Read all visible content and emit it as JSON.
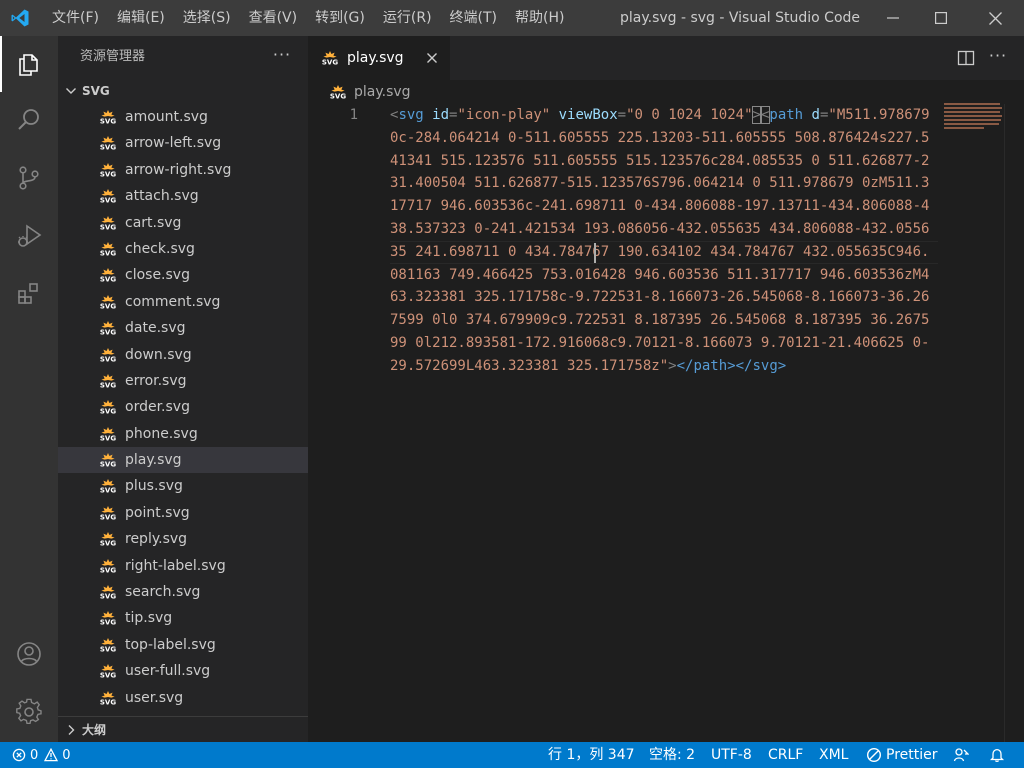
{
  "window": {
    "title": "play.svg - svg - Visual Studio Code",
    "menu": [
      "文件(F)",
      "编辑(E)",
      "选择(S)",
      "查看(V)",
      "转到(G)",
      "运行(R)",
      "终端(T)",
      "帮助(H)"
    ]
  },
  "activity_bar": {
    "items": [
      "explorer-icon",
      "search-icon",
      "source-control-icon",
      "run-debug-icon",
      "extensions-icon"
    ],
    "bottom": [
      "account-icon",
      "settings-gear-icon"
    ],
    "active": "explorer-icon"
  },
  "sidebar": {
    "title": "资源管理器",
    "more": "···",
    "folder": "SVG",
    "files": [
      "amount.svg",
      "arrow-left.svg",
      "arrow-right.svg",
      "attach.svg",
      "cart.svg",
      "check.svg",
      "close.svg",
      "comment.svg",
      "date.svg",
      "down.svg",
      "error.svg",
      "order.svg",
      "phone.svg",
      "play.svg",
      "plus.svg",
      "point.svg",
      "reply.svg",
      "right-label.svg",
      "search.svg",
      "tip.svg",
      "top-label.svg",
      "user-full.svg",
      "user.svg"
    ],
    "selected_file": "play.svg",
    "outline_label": "大纲"
  },
  "editor": {
    "tab_label": "play.svg",
    "breadcrumb": "play.svg",
    "more": "···",
    "line_number": "1",
    "code": {
      "open1": "<",
      "svg_tag": "svg",
      "id_attr": "id",
      "eq": "=",
      "id_val": "\"icon-play\"",
      "viewbox_attr": "viewBox",
      "viewbox_val": "\"0 0 1024 1024\"",
      "close1": ">",
      "open2": "<",
      "path_tag": "path",
      "d_attr": "d",
      "d_val": "\"M511.978679 0c-284.064214 0-511.605555 225.13203-511.605555 508.876424s227.541341 515.123576 511.605555 515.123576c284.085535 0 511.626877-231.400504 511.626877-515.123576S796.064214 0 511.978679 0zM511.317717 946.603536c-241.698711 0-434.806088-197.13711-434.806088-438.537323 0-241.421534 193.086056-432.055635 434.806088-432.055635 241.698711 0 434.784767 190.634102 434.784767 432.055635C946.081163 749.466425 753.016428 946.603536 511.317717 946.603536zM463.323381 325.171758c-9.722531-8.166073-26.545068-8.166073-36.267599 0l0 374.679909c9.722531 8.187395 26.545068 8.187395 36.267599 0l212.893581-172.916068c9.70121-8.166073 9.70121-21.406625 0-29.572699L463.323381 325.171758z\"",
      "close2": ">",
      "end_path": "</path>",
      "end_svg": "</svg>"
    }
  },
  "status_bar": {
    "errors": "0",
    "warnings": "0",
    "position": "行 1，列 347",
    "indent": "空格: 2",
    "encoding": "UTF-8",
    "eol": "CRLF",
    "language": "XML",
    "formatter": "Prettier"
  },
  "colors": {
    "accent": "#007acc",
    "vscode_logo": "#23a9f2",
    "svg_icon": "#ffb13b"
  }
}
